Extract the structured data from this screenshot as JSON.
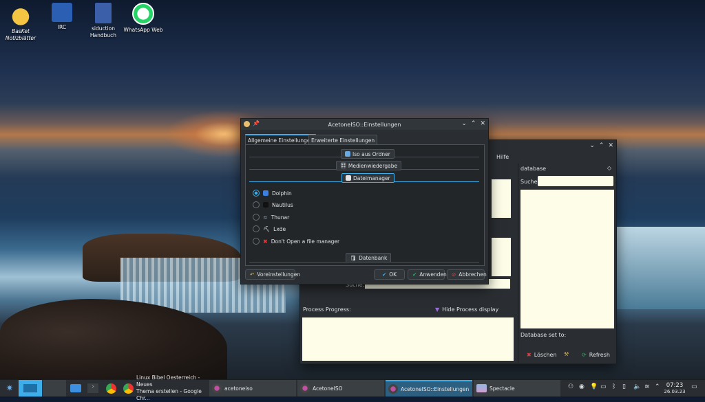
{
  "desktop": {
    "icons": [
      {
        "line1": "BasKet",
        "line2": "Notizblätter",
        "icon": "basket-icon"
      },
      {
        "line1": "IRC",
        "line2": "",
        "icon": "irc-icon"
      },
      {
        "line1": "siduction",
        "line2": "Handbuch",
        "icon": "book-icon"
      },
      {
        "line1": "WhatsApp Web",
        "line2": "",
        "icon": "whatsapp-icon"
      }
    ]
  },
  "bg_window": {
    "menu_hilfe": "Hilfe",
    "database_title": "database",
    "suche_label": "Suche:",
    "suche_label_left": "Suche:",
    "process_progress": "Process Progress:",
    "hide_process": "Hide Process display",
    "database_set_to": "Database set to:",
    "loeschen": "Löschen",
    "refresh": "Refresh"
  },
  "dialog": {
    "title": "AcetoneISO::Einstellungen",
    "tabs": [
      "Allgemeine Einstellungen",
      "Erweiterte Einstellungen"
    ],
    "sections": {
      "iso_aus_ordner": "Iso aus Ordner",
      "medienwiedergabe": "Medienwiedergabe",
      "dateimanager": "Dateimanager",
      "datenbank": "Datenbank"
    },
    "options": [
      "Dolphin",
      "Nautilus",
      "Thunar",
      "Lxde",
      "Don't Open a file manager"
    ],
    "selected": "Dolphin",
    "buttons": {
      "voreinstellungen": "Voreinstellungen",
      "ok": "OK",
      "anwenden": "Anwenden",
      "abbrechen": "Abbrechen"
    }
  },
  "taskbar": {
    "tasks": [
      {
        "line1": "Linux Bibel Oesterreich - Neues",
        "line2": "Thema erstellen - Google Chr..."
      },
      {
        "line1": "acetoneiso",
        "line2": ""
      },
      {
        "line1": "AcetoneISO",
        "line2": ""
      },
      {
        "line1": "AcetoneISO::Einstellungen",
        "line2": ""
      },
      {
        "line1": "Spectacle",
        "line2": ""
      }
    ],
    "clock_time": "07:23",
    "clock_date": "26.03.23"
  },
  "colors": {
    "accent": "#3daee9",
    "window_bg": "#2a2e32",
    "panel_bg": "#31363b",
    "textbox_bg": "#fdfde8"
  }
}
